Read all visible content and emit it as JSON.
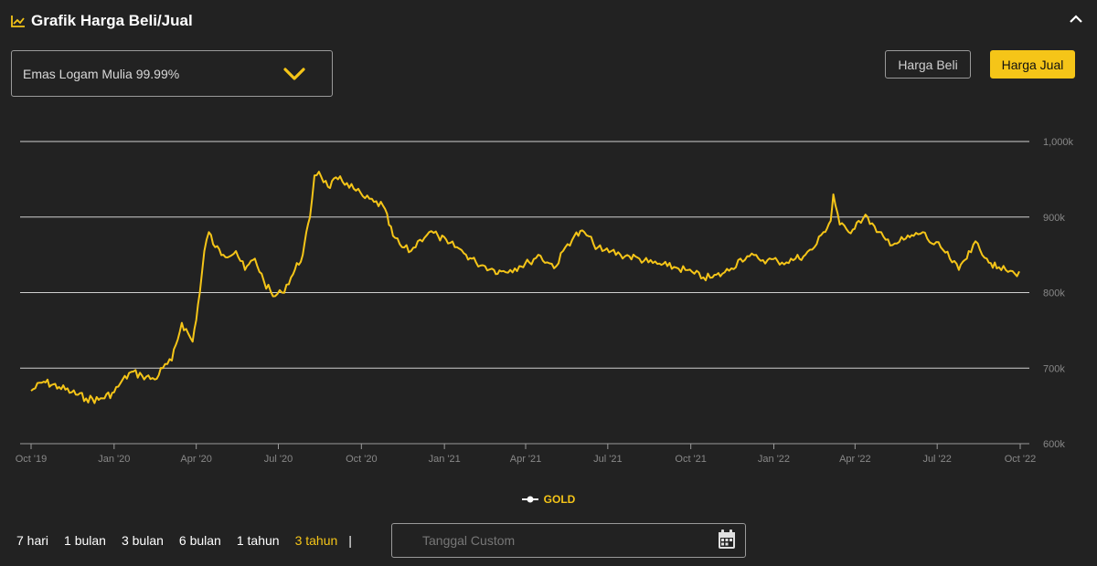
{
  "header": {
    "title": "Grafik Harga Beli/Jual"
  },
  "product": {
    "selected": "Emas Logam Mulia 99.99%"
  },
  "buttons": {
    "beli": "Harga Beli",
    "jual": "Harga Jual",
    "active": "jual"
  },
  "legend": {
    "label": "GOLD"
  },
  "ranges": [
    "7 hari",
    "1 bulan",
    "3 bulan",
    "6 bulan",
    "1 tahun",
    "3 tahun"
  ],
  "active_range": "3 tahun",
  "range_separator": "|",
  "custom_date": {
    "placeholder": "Tanggal Custom"
  },
  "colors": {
    "accent": "#f5c518",
    "background": "#222222",
    "grid": "#d0d0d0"
  },
  "icons": {
    "header": "chart-line-icon",
    "collapse": "chevron-up-icon",
    "select": "chevron-down-icon",
    "date": "calendar-icon"
  },
  "chart_data": {
    "type": "line",
    "title": "",
    "xlabel": "",
    "ylabel": "",
    "xlim": [
      "2019-10-01",
      "2022-10-01"
    ],
    "ylim": [
      600000,
      1000000
    ],
    "x_ticks": [
      "2019-10-01",
      "2020-01-01",
      "2020-04-01",
      "2020-07-01",
      "2020-10-01",
      "2021-01-01",
      "2021-04-01",
      "2021-07-01",
      "2021-10-01",
      "2022-01-01",
      "2022-04-01",
      "2022-07-01",
      "2022-10-01"
    ],
    "x_tick_labels": [
      "Oct '19",
      "Jan '20",
      "Apr '20",
      "Jul '20",
      "Oct '20",
      "Jan '21",
      "Apr '21",
      "Jul '21",
      "Oct '21",
      "Jan '22",
      "Apr '22",
      "Jul '22",
      "Oct '22"
    ],
    "y_ticks": [
      600000,
      700000,
      800000,
      900000,
      1000000
    ],
    "y_tick_labels": [
      "600k",
      "700k",
      "800k",
      "900k",
      "1,000k"
    ],
    "grid": true,
    "y_axis_side": "right",
    "series": [
      {
        "name": "GOLD",
        "x": [
          "2019-10-01",
          "2019-10-15",
          "2019-11-01",
          "2019-11-15",
          "2019-12-01",
          "2019-12-15",
          "2020-01-01",
          "2020-01-08",
          "2020-01-20",
          "2020-02-01",
          "2020-02-15",
          "2020-02-24",
          "2020-03-05",
          "2020-03-16",
          "2020-03-28",
          "2020-04-05",
          "2020-04-10",
          "2020-04-15",
          "2020-04-22",
          "2020-05-01",
          "2020-05-15",
          "2020-05-25",
          "2020-06-05",
          "2020-06-15",
          "2020-06-25",
          "2020-07-05",
          "2020-07-15",
          "2020-07-28",
          "2020-08-05",
          "2020-08-10",
          "2020-08-15",
          "2020-08-25",
          "2020-09-05",
          "2020-09-15",
          "2020-09-25",
          "2020-10-05",
          "2020-10-15",
          "2020-10-25",
          "2020-11-05",
          "2020-11-15",
          "2020-11-25",
          "2020-12-05",
          "2020-12-15",
          "2020-12-25",
          "2021-01-05",
          "2021-01-15",
          "2021-01-25",
          "2021-02-05",
          "2021-02-15",
          "2021-02-25",
          "2021-03-05",
          "2021-03-15",
          "2021-03-25",
          "2021-04-05",
          "2021-04-15",
          "2021-04-25",
          "2021-05-05",
          "2021-05-15",
          "2021-05-25",
          "2021-06-05",
          "2021-06-15",
          "2021-06-25",
          "2021-07-05",
          "2021-07-15",
          "2021-07-25",
          "2021-08-05",
          "2021-08-15",
          "2021-08-25",
          "2021-09-05",
          "2021-09-15",
          "2021-09-25",
          "2021-10-05",
          "2021-10-15",
          "2021-10-25",
          "2021-11-05",
          "2021-11-15",
          "2021-11-25",
          "2021-12-05",
          "2021-12-15",
          "2021-12-25",
          "2022-01-05",
          "2022-01-15",
          "2022-01-25",
          "2022-02-05",
          "2022-02-15",
          "2022-02-25",
          "2022-03-05",
          "2022-03-08",
          "2022-03-15",
          "2022-03-25",
          "2022-04-05",
          "2022-04-15",
          "2022-04-25",
          "2022-05-05",
          "2022-05-15",
          "2022-05-25",
          "2022-06-05",
          "2022-06-15",
          "2022-06-25",
          "2022-07-05",
          "2022-07-15",
          "2022-07-25",
          "2022-08-05",
          "2022-08-15",
          "2022-08-25",
          "2022-09-05",
          "2022-09-15",
          "2022-09-25",
          "2022-09-30"
        ],
        "y": [
          670000,
          682000,
          675000,
          668000,
          660000,
          658000,
          668000,
          680000,
          695000,
          690000,
          685000,
          700000,
          710000,
          760000,
          735000,
          800000,
          855000,
          880000,
          860000,
          850000,
          855000,
          830000,
          845000,
          815000,
          795000,
          800000,
          820000,
          850000,
          900000,
          955000,
          960000,
          940000,
          950000,
          945000,
          935000,
          925000,
          920000,
          915000,
          875000,
          860000,
          855000,
          870000,
          880000,
          875000,
          865000,
          860000,
          850000,
          840000,
          835000,
          830000,
          828000,
          830000,
          835000,
          840000,
          850000,
          840000,
          835000,
          860000,
          875000,
          880000,
          865000,
          855000,
          855000,
          850000,
          848000,
          845000,
          840000,
          838000,
          835000,
          833000,
          830000,
          825000,
          820000,
          820000,
          825000,
          832000,
          845000,
          848000,
          845000,
          843000,
          842000,
          840000,
          845000,
          850000,
          860000,
          880000,
          895000,
          930000,
          890000,
          880000,
          895000,
          900000,
          880000,
          870000,
          865000,
          870000,
          875000,
          880000,
          865000,
          860000,
          845000,
          830000,
          855000,
          865000,
          845000,
          832000,
          830000,
          825000,
          828000
        ]
      }
    ]
  }
}
